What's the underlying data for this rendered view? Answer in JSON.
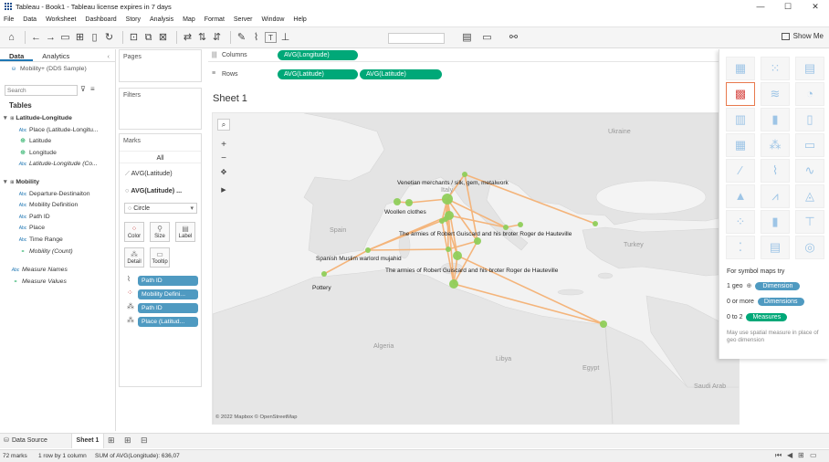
{
  "window": {
    "title": "Tableau - Book1 - Tableau license expires in 7 days",
    "min": "—",
    "max": "☐",
    "close": "✕"
  },
  "menu": [
    "File",
    "Data",
    "Worksheet",
    "Dashboard",
    "Story",
    "Analysis",
    "Map",
    "Format",
    "Server",
    "Window",
    "Help"
  ],
  "toolbar": {
    "show_me": "Show Me"
  },
  "side": {
    "tab_data": "Data",
    "tab_analytics": "Analytics",
    "datasource": "Mobility+ (DDS Sample)",
    "search_placeholder": "Search",
    "tables_heading": "Tables",
    "groups": [
      {
        "name": "Latitude-Longitude",
        "fields": [
          {
            "type": "Abc",
            "name": "Place (Latitude-Longitu..."
          },
          {
            "type": "⊕",
            "name": "Latitude"
          },
          {
            "type": "⊕",
            "name": "Longitude"
          },
          {
            "type": "Abc",
            "name": "Latitude-Longitude (Co..."
          }
        ]
      },
      {
        "name": "Mobility",
        "fields": [
          {
            "type": "Abc",
            "name": "Departure-Destinaiton"
          },
          {
            "type": "Abc",
            "name": "Mobility Definition"
          },
          {
            "type": "Abc",
            "name": "Path ID"
          },
          {
            "type": "Abc",
            "name": "Place"
          },
          {
            "type": "Abc",
            "name": "Time Range"
          },
          {
            "type": "=",
            "name": "Mobility (Count)"
          }
        ]
      }
    ],
    "measure_names": "Measure Names",
    "measure_values": "Measure Values"
  },
  "cards": {
    "pages": "Pages",
    "filters": "Filters",
    "marks": "Marks",
    "all": "All",
    "mark_row1": "AVG(Latitude)",
    "mark_row2": "AVG(Latitude) ...",
    "mark_type": "Circle",
    "btn_color": "Color",
    "btn_size": "Size",
    "btn_label": "Label",
    "btn_detail": "Detail",
    "btn_tooltip": "Tooltip",
    "mark_pills": [
      "Path ID",
      "Mobility Defini...",
      "Path ID",
      "Place (Latitud..."
    ]
  },
  "shelves": {
    "columns_label": "Columns",
    "rows_label": "Rows",
    "columns_pill": "AVG(Longitude)",
    "rows_pill1": "AVG(Latitude)",
    "rows_pill2": "AVG(Latitude)"
  },
  "sheet": {
    "title": "Sheet 1",
    "attribution": "© 2022 Mapbox © OpenStreetMap"
  },
  "map_labels": {
    "countries": [
      "Ukraine",
      "Italy",
      "Spain",
      "Turkey",
      "Algeria",
      "Libya",
      "Egypt",
      "Saudi Arab"
    ],
    "annotations": [
      "Venetian merchants / silk, gem, metalwork",
      "Woollen clothes",
      "The armies of Robert Guiscard and his broter Roger de Hauteville",
      "Spanish Muslim warlord mujahid",
      "The armies of Robert Guiscard and his broter Roger de Hauteville",
      "Pottery"
    ]
  },
  "colors": {
    "accent": "#00a878",
    "marks": "#8fcd5a",
    "paths": "#f4b47a",
    "pill_blue": "#4f9ac1"
  },
  "showme": {
    "heading": "For symbol maps try",
    "row1_pre": "1 geo",
    "row1_pill": "Dimension",
    "row2_pre": "0 or more",
    "row2_pill": "Dimensions",
    "row3_pre": "0 to 2",
    "row3_pill": "Measures",
    "note": "May use spatial measure in place of geo dimension"
  },
  "sheettabs": {
    "datasource": "Data Source",
    "sheet1": "Sheet 1"
  },
  "status": {
    "marks": "72 marks",
    "rows": "1 row by 1 column",
    "sum": "SUM of AVG(Longitude): 636,07"
  }
}
